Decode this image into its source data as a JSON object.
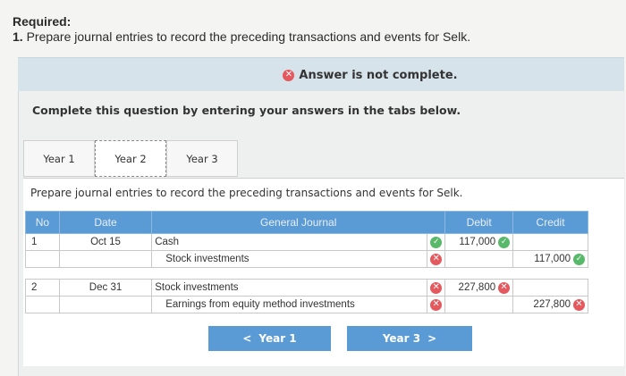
{
  "required": {
    "label": "Required:",
    "number": "1.",
    "text": "Prepare journal entries to record the preceding transactions and events for Selk."
  },
  "banner": {
    "icon": "x-circle-icon",
    "text": "Answer is not complete."
  },
  "instruction": "Complete this question by entering your answers in the tabs below.",
  "tabs": [
    {
      "label": "Year 1"
    },
    {
      "label": "Year 2"
    },
    {
      "label": "Year 3"
    }
  ],
  "active_tab": "Year 2",
  "sub_instruction": "Prepare journal entries to record the preceding transactions and events for Selk.",
  "table": {
    "headers": [
      "No",
      "Date",
      "General Journal",
      "Debit",
      "Credit"
    ],
    "rows": [
      {
        "no": "1",
        "date": "Oct 15",
        "account": "Cash",
        "mark": "check",
        "debit": "117,000",
        "debit_mark": "check",
        "credit": "",
        "credit_mark": ""
      },
      {
        "no": "",
        "date": "",
        "account": "Stock investments",
        "mark": "x",
        "debit": "",
        "debit_mark": "",
        "credit": "117,000",
        "credit_mark": "check"
      },
      {
        "no": "2",
        "date": "Dec 31",
        "account": "Stock investments",
        "mark": "x",
        "debit": "227,800",
        "debit_mark": "x",
        "credit": "",
        "credit_mark": ""
      },
      {
        "no": "",
        "date": "",
        "account": "Earnings from equity method investments",
        "mark": "x",
        "debit": "",
        "debit_mark": "",
        "credit": "227,800",
        "credit_mark": "x"
      }
    ]
  },
  "nav": {
    "prev": {
      "arrow": "<",
      "label": "Year 1"
    },
    "next": {
      "label": "Year 3",
      "arrow": ">"
    }
  },
  "colors": {
    "accent": "#5b9bd5",
    "banner_bg": "#d7e3ea",
    "error": "#e4585e",
    "success": "#59b96a"
  }
}
